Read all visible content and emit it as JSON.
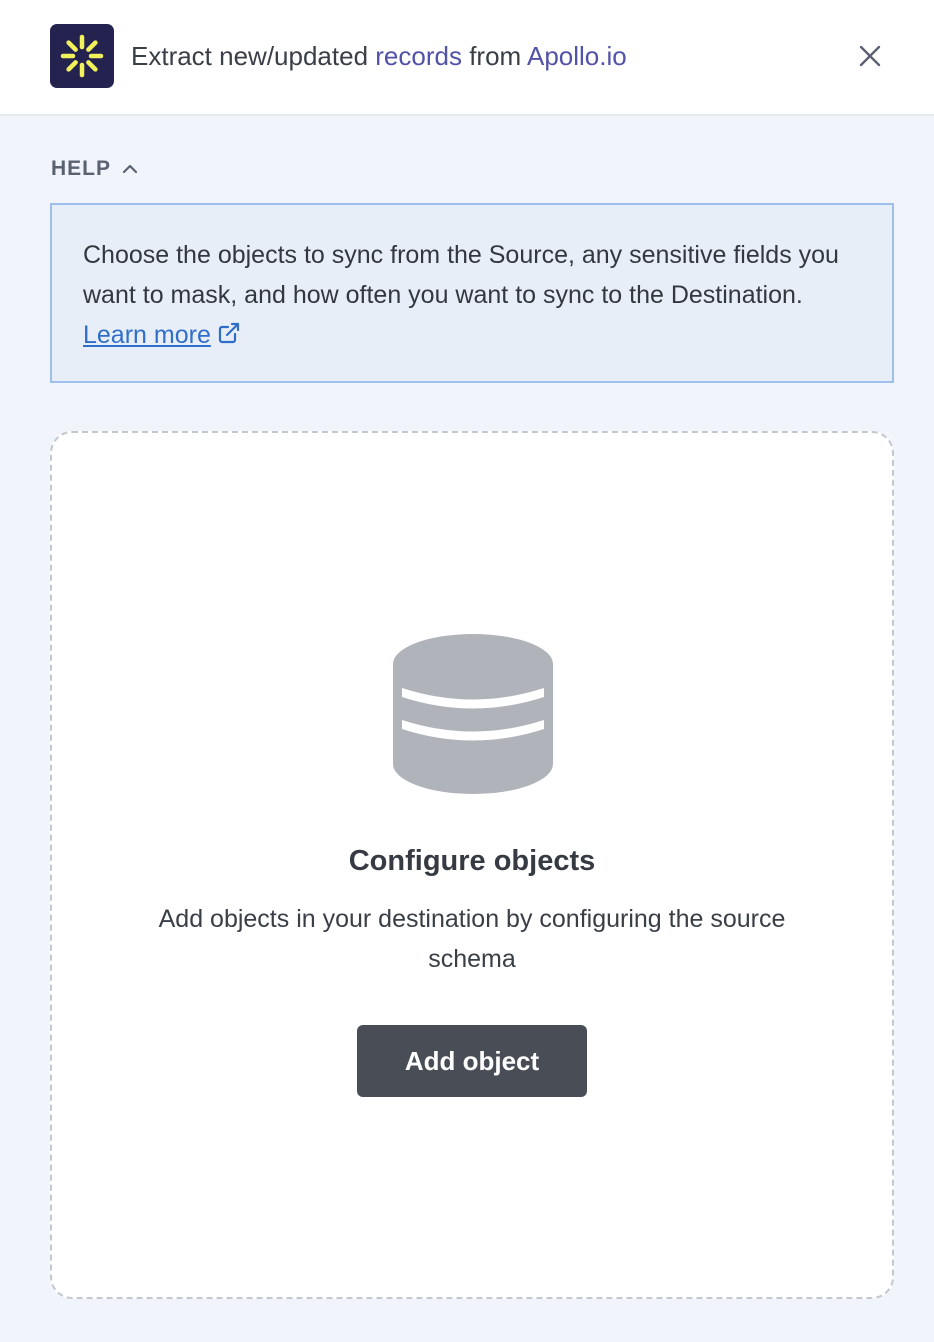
{
  "header": {
    "title_prefix": "Extract new/updated ",
    "title_object": "records",
    "title_mid": " from ",
    "title_source": "Apollo.io",
    "logo_icon": "apollo-logo-icon",
    "close_icon": "close-icon"
  },
  "help": {
    "label": "HELP",
    "toggle_icon": "chevron-up-icon",
    "text": "Choose the objects to sync from the Source, any sensitive fields you want to mask, and how often you want to sync to the Destination. ",
    "link_label": "Learn more",
    "link_icon": "external-link-icon"
  },
  "empty_state": {
    "icon": "database-icon",
    "title": "Configure objects",
    "description": "Add objects in your destination by configuring the source schema",
    "button_label": "Add object"
  },
  "colors": {
    "header_bg": "#ffffff",
    "page_bg": "#f1f4fa",
    "logo_bg": "#24224f",
    "logo_accent": "#f2f25a",
    "highlight_text": "#5152a8",
    "help_bg": "#e8eef8",
    "help_border": "#9fc0ec",
    "link": "#2f6ec9",
    "icon_gray": "#b0b4ba",
    "button_bg": "#484d56"
  }
}
